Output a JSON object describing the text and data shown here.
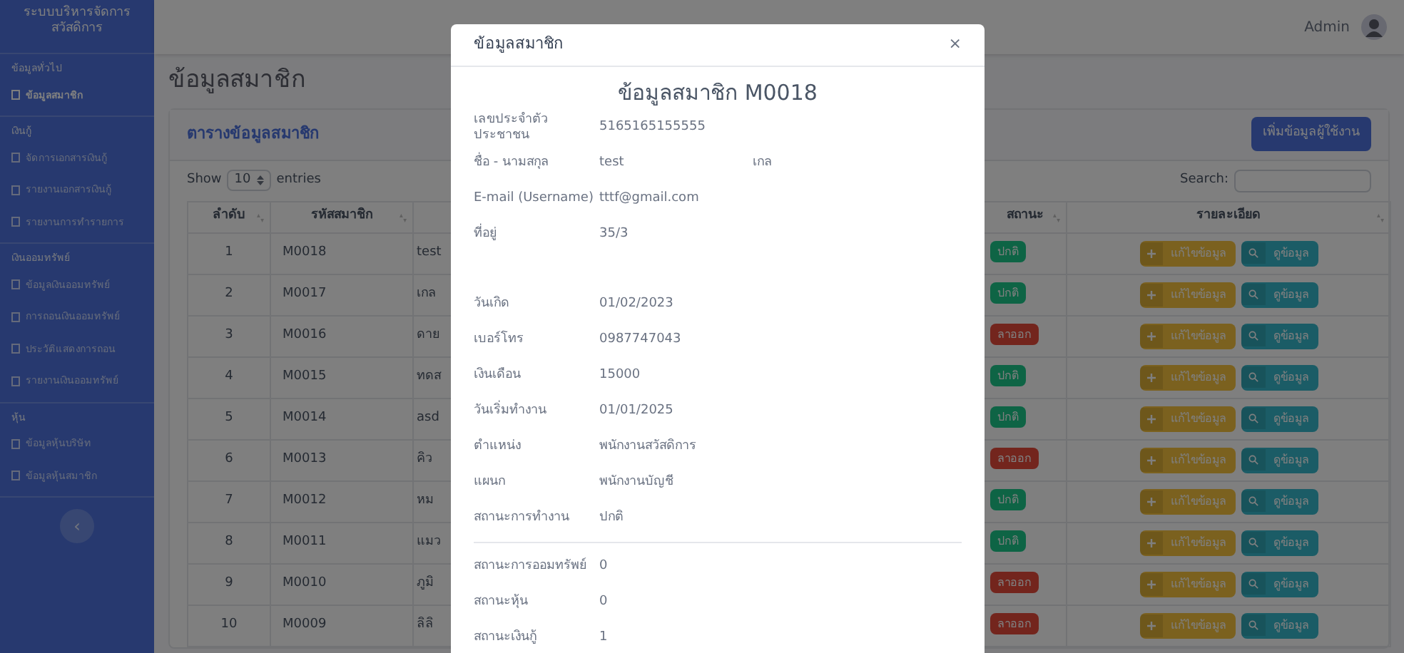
{
  "sidebar": {
    "brand": "ระบบบริหารจัดการสวัสดิการ",
    "sections": [
      {
        "heading": "ข้อมูลทั่วไป",
        "items": [
          {
            "label": "ข้อมูลสมาชิก",
            "selected": true
          }
        ]
      },
      {
        "heading": "เงินกู้",
        "items": [
          {
            "label": "จัดการเอกสารเงินกู้",
            "selected": false
          },
          {
            "label": "รายงานเอกสารเงินกู้",
            "selected": false
          },
          {
            "label": "รายงานการทำรายการ",
            "selected": false
          }
        ]
      },
      {
        "heading": "เงินออมทรัพย์",
        "items": [
          {
            "label": "ข้อมูลเงินออมทรัพย์",
            "selected": false
          },
          {
            "label": "การถอนเงินออมทรัพย์",
            "selected": false
          },
          {
            "label": "ประวัติแสดงการถอน",
            "selected": false
          },
          {
            "label": "รายงานเงินออมทรัพย์",
            "selected": false
          }
        ]
      },
      {
        "heading": "หุ้น",
        "items": [
          {
            "label": "ข้อมูลหุ้นบริษัท",
            "selected": false
          },
          {
            "label": "ข้อมูลหุ้นสมาชิก",
            "selected": false
          }
        ]
      }
    ],
    "collapse_button": "‹"
  },
  "topbar": {
    "user": "Admin"
  },
  "page_title": "ข้อมูลสมาชิก",
  "card": {
    "title": "ตารางข้อมูลสมาชิก",
    "add_button": "เพิ่มข้อมูลผู้ใช้งาน",
    "show_prefix": "Show",
    "page_size": "10",
    "show_suffix": "entries",
    "search_label": "Search:"
  },
  "table": {
    "columns": [
      {
        "label": "ลำดับ"
      },
      {
        "label": "รหัสสมาชิก"
      },
      {},
      {
        "label": "สถานะ"
      },
      {
        "label": "รายละเอียด"
      }
    ],
    "rows": [
      {
        "no": "1",
        "code": "M0018",
        "name": "test",
        "status": "ปกติ",
        "kind": "active",
        "edit": "แก้ไขข้อมูล",
        "view": "ดูข้อมูล"
      },
      {
        "no": "2",
        "code": "M0017",
        "name": "เกล",
        "status": "ปกติ",
        "kind": "active",
        "edit": "แก้ไขข้อมูล",
        "view": "ดูข้อมูล"
      },
      {
        "no": "3",
        "code": "M0016",
        "name": "ดาย",
        "status": "ลาออก",
        "kind": "resigned",
        "edit": "แก้ไขข้อมูล",
        "view": "ดูข้อมูล"
      },
      {
        "no": "4",
        "code": "M0015",
        "name": "ทดส",
        "status": "ปกติ",
        "kind": "active",
        "edit": "แก้ไขข้อมูล",
        "view": "ดูข้อมูล"
      },
      {
        "no": "5",
        "code": "M0014",
        "name": "asd",
        "status": "ปกติ",
        "kind": "active",
        "edit": "แก้ไขข้อมูล",
        "view": "ดูข้อมูล"
      },
      {
        "no": "6",
        "code": "M0013",
        "name": "คิว",
        "status": "ลาออก",
        "kind": "resigned",
        "edit": "แก้ไขข้อมูล",
        "view": "ดูข้อมูล"
      },
      {
        "no": "7",
        "code": "M0012",
        "name": "หม",
        "status": "ปกติ",
        "kind": "active",
        "edit": "แก้ไขข้อมูล",
        "view": "ดูข้อมูล"
      },
      {
        "no": "8",
        "code": "M0011",
        "name": "แมว",
        "status": "ปกติ",
        "kind": "active",
        "edit": "แก้ไขข้อมูล",
        "view": "ดูข้อมูล"
      },
      {
        "no": "9",
        "code": "M0010",
        "name": "ภูมิ",
        "status": "ลาออก",
        "kind": "resigned",
        "edit": "แก้ไขข้อมูล",
        "view": "ดูข้อมูล"
      },
      {
        "no": "10",
        "code": "M0009",
        "name": "ลิลิ",
        "status": "ลาออก",
        "kind": "resigned",
        "edit": "แก้ไขข้อมูล",
        "view": "ดูข้อมูล"
      }
    ]
  },
  "modal": {
    "title": "ข้อมูลสมาชิก",
    "close": "×",
    "heading": "ข้อมูลสมาชิก M0018",
    "fields": [
      {
        "kind": "text",
        "label": "เลขประจำตัวประชาชน",
        "values": [
          "5165165155555"
        ]
      },
      {
        "kind": "text",
        "label": "ชื่อ - นามสกุล",
        "values": [
          "test",
          "เกล"
        ]
      },
      {
        "kind": "text",
        "label": "E-mail (Username)",
        "values": [
          "tttf@gmail.com"
        ]
      },
      {
        "kind": "textarea",
        "label": "ที่อยู่",
        "values": [
          "35/3"
        ]
      },
      {
        "kind": "text",
        "label": "วันเกิด",
        "values": [
          "01/02/2023"
        ]
      },
      {
        "kind": "text",
        "label": "เบอร์โทร",
        "values": [
          "0987747043"
        ]
      },
      {
        "kind": "text",
        "label": "เงินเดือน",
        "values": [
          "15000"
        ]
      },
      {
        "kind": "text",
        "label": "วันเริ่มทำงาน",
        "values": [
          "01/01/2025"
        ]
      },
      {
        "kind": "text",
        "label": "ตำแหน่ง",
        "values": [
          "พนักงานสวัสดิการ"
        ]
      },
      {
        "kind": "text",
        "label": "แผนก",
        "values": [
          "พนักงานบัญชี"
        ]
      },
      {
        "kind": "text",
        "label": "สถานะการทำงาน",
        "values": [
          "ปกติ"
        ]
      },
      {
        "kind": "divider"
      },
      {
        "kind": "text",
        "label": "สถานะการออมทรัพย์",
        "values": [
          "0"
        ]
      },
      {
        "kind": "text",
        "label": "สถานะหุ้น",
        "values": [
          "0"
        ]
      },
      {
        "kind": "text",
        "label": "สถานะเงินกู้",
        "values": [
          "1"
        ]
      }
    ]
  }
}
